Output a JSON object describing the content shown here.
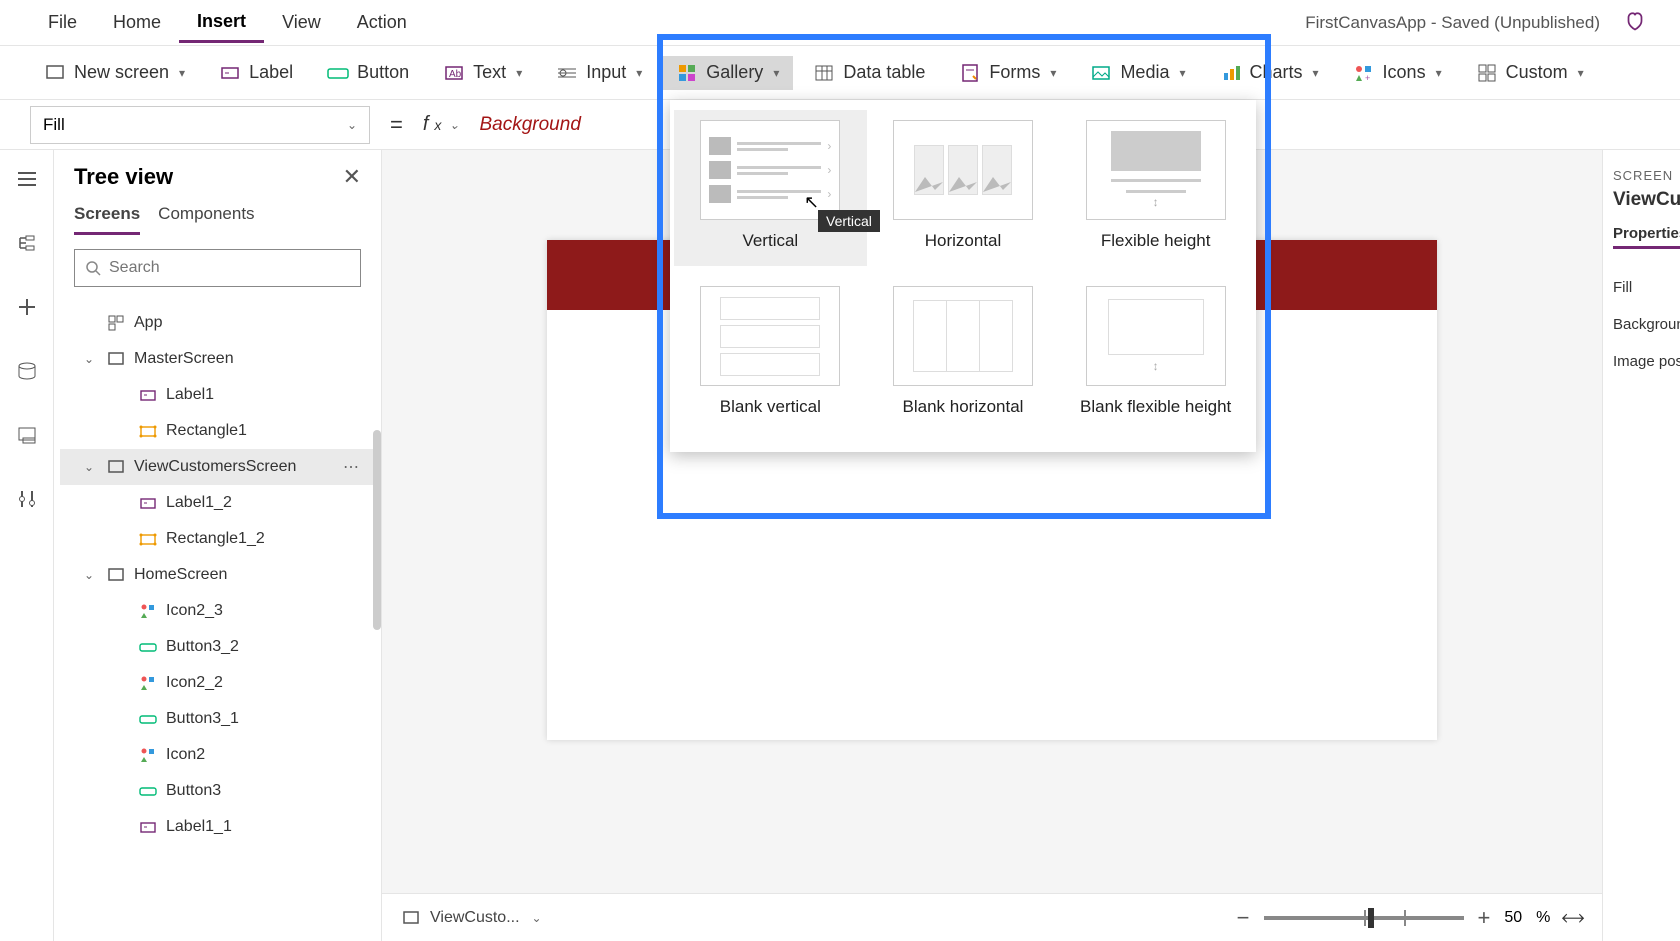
{
  "menubar": {
    "items": [
      "File",
      "Home",
      "Insert",
      "View",
      "Action"
    ],
    "active": "Insert"
  },
  "app_status": "FirstCanvasApp - Saved (Unpublished)",
  "ribbon": {
    "new_screen": "New screen",
    "label": "Label",
    "button": "Button",
    "text": "Text",
    "input": "Input",
    "gallery": "Gallery",
    "data_table": "Data table",
    "forms": "Forms",
    "media": "Media",
    "charts": "Charts",
    "icons": "Icons",
    "custom": "Custom"
  },
  "formula": {
    "property": "Fill",
    "text": "Background"
  },
  "tree": {
    "title": "Tree view",
    "tabs": [
      "Screens",
      "Components"
    ],
    "active_tab": "Screens",
    "search_placeholder": "Search",
    "items": [
      {
        "label": "App",
        "depth": 1,
        "icon": "app",
        "exp": ""
      },
      {
        "label": "MasterScreen",
        "depth": 1,
        "icon": "screen",
        "exp": "v"
      },
      {
        "label": "Label1",
        "depth": 2,
        "icon": "label",
        "exp": ""
      },
      {
        "label": "Rectangle1",
        "depth": 2,
        "icon": "rect",
        "exp": ""
      },
      {
        "label": "ViewCustomersScreen",
        "depth": 1,
        "icon": "screen",
        "exp": "v",
        "selected": true,
        "more": true
      },
      {
        "label": "Label1_2",
        "depth": 2,
        "icon": "label",
        "exp": ""
      },
      {
        "label": "Rectangle1_2",
        "depth": 2,
        "icon": "rect",
        "exp": ""
      },
      {
        "label": "HomeScreen",
        "depth": 1,
        "icon": "screen",
        "exp": "v"
      },
      {
        "label": "Icon2_3",
        "depth": 2,
        "icon": "icons",
        "exp": ""
      },
      {
        "label": "Button3_2",
        "depth": 2,
        "icon": "button",
        "exp": ""
      },
      {
        "label": "Icon2_2",
        "depth": 2,
        "icon": "icons",
        "exp": ""
      },
      {
        "label": "Button3_1",
        "depth": 2,
        "icon": "button",
        "exp": ""
      },
      {
        "label": "Icon2",
        "depth": 2,
        "icon": "icons",
        "exp": ""
      },
      {
        "label": "Button3",
        "depth": 2,
        "icon": "button",
        "exp": ""
      },
      {
        "label": "Label1_1",
        "depth": 2,
        "icon": "label",
        "exp": ""
      }
    ]
  },
  "gallery_popup": {
    "tooltip": "Vertical",
    "options": [
      "Vertical",
      "Horizontal",
      "Flexible height",
      "Blank vertical",
      "Blank horizontal",
      "Blank flexible height"
    ]
  },
  "canvas_footer": {
    "screen_name": "ViewCusto...",
    "zoom_pct": "50",
    "pct_sign": "%"
  },
  "props": {
    "section": "SCREEN",
    "name": "ViewCusto",
    "tab": "Properties",
    "rows": [
      "Fill",
      "Background",
      "Image posit"
    ]
  }
}
